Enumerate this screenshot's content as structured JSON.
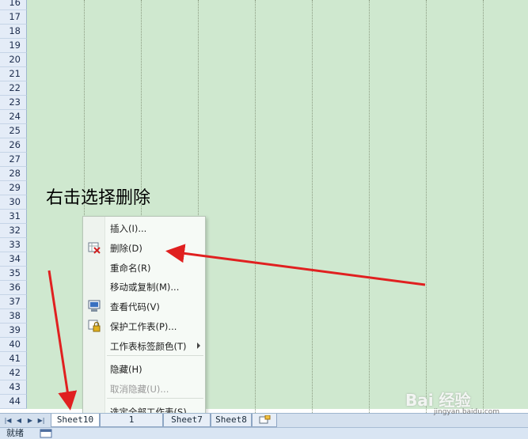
{
  "sheet": {
    "rows": [
      "16",
      "17",
      "18",
      "19",
      "20",
      "21",
      "22",
      "23",
      "24",
      "25",
      "26",
      "27",
      "28",
      "29",
      "30",
      "31",
      "32",
      "33",
      "34",
      "35",
      "36",
      "37",
      "38",
      "39",
      "40",
      "41",
      "42",
      "43",
      "44"
    ],
    "cell_color": "#cfe8cf"
  },
  "annotation": {
    "text": "右击选择删除"
  },
  "context_menu": {
    "items": [
      {
        "label": "插入(I)...",
        "icon": null,
        "disabled": false,
        "submenu": false
      },
      {
        "label": "删除(D)",
        "icon": "delete-sheet-icon",
        "disabled": false,
        "submenu": false
      },
      {
        "label": "重命名(R)",
        "icon": null,
        "disabled": false,
        "submenu": false
      },
      {
        "label": "移动或复制(M)...",
        "icon": null,
        "disabled": false,
        "submenu": false
      },
      {
        "label": "查看代码(V)",
        "icon": "view-code-icon",
        "disabled": false,
        "submenu": false
      },
      {
        "label": "保护工作表(P)...",
        "icon": "protect-sheet-icon",
        "disabled": false,
        "submenu": false
      },
      {
        "label": "工作表标签颜色(T)",
        "icon": null,
        "disabled": false,
        "submenu": true
      },
      {
        "label": "隐藏(H)",
        "icon": null,
        "disabled": false,
        "submenu": false
      },
      {
        "label": "取消隐藏(U)...",
        "icon": null,
        "disabled": true,
        "submenu": false
      },
      {
        "label": "选定全部工作表(S)",
        "icon": null,
        "disabled": false,
        "submenu": false
      }
    ]
  },
  "tabs": {
    "sheets": [
      "Sheet10",
      "1",
      "Sheet7",
      "Sheet8"
    ],
    "active": "Sheet10",
    "nav_icons": [
      "first-sheet-icon",
      "prev-sheet-icon",
      "next-sheet-icon",
      "last-sheet-icon"
    ],
    "new_sheet_icon": "insert-sheet-icon"
  },
  "status": {
    "text": "就绪"
  },
  "watermark": {
    "logo": "Bai 经验",
    "sub": "jingyan.baidu.com"
  },
  "colors": {
    "arrow": "#e02020",
    "menu_bg": "#f6faf6",
    "tab_active": "#ffffff"
  }
}
